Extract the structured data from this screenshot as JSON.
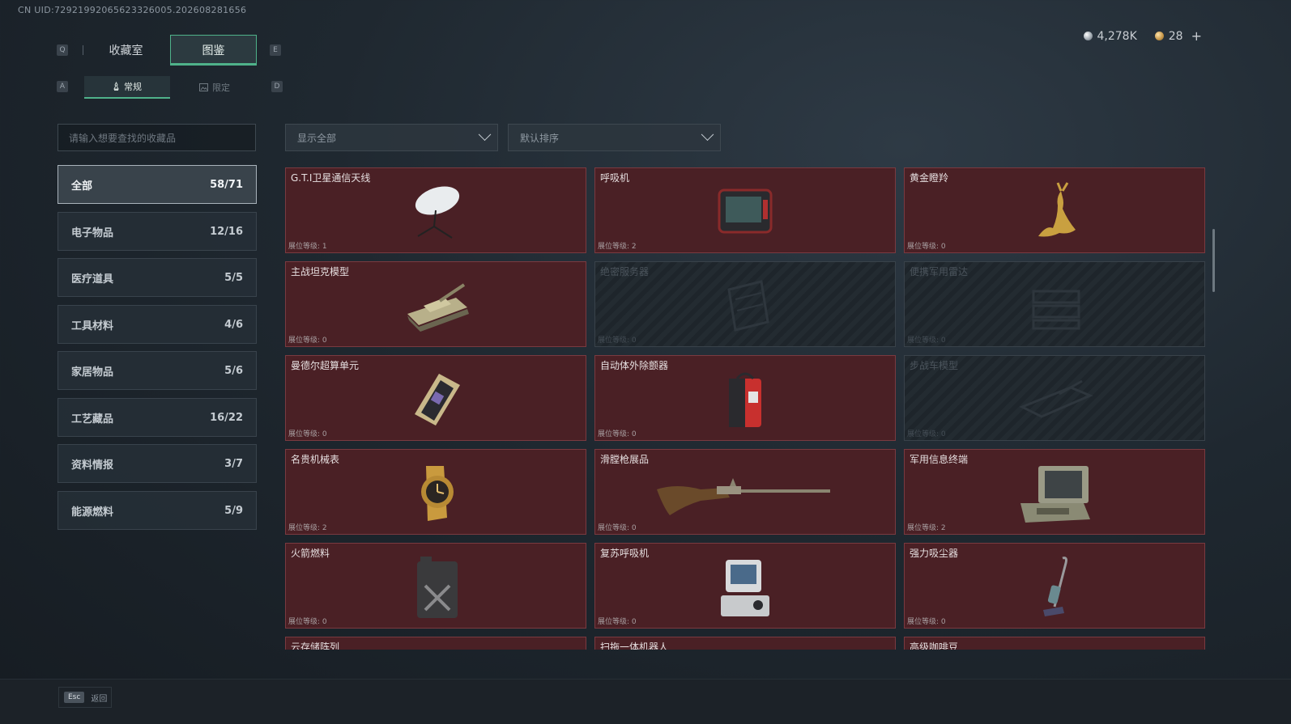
{
  "uid_text": "CN UID:72921992065623326005.202608281656",
  "currency": {
    "silver": "4,278K",
    "gold": "28",
    "add": "+"
  },
  "keys": {
    "prev_tab": "Q",
    "next_tab": "E",
    "prev_sub": "A",
    "next_sub": "D"
  },
  "tabs": [
    {
      "label": "收藏室"
    },
    {
      "label": "图鉴",
      "active": true
    }
  ],
  "subtabs": [
    {
      "label": "常规",
      "active": true
    },
    {
      "label": "限定"
    }
  ],
  "search": {
    "placeholder": "请输入想要查找的收藏品"
  },
  "filters": {
    "show": "显示全部",
    "sort": "默认排序"
  },
  "categories": [
    {
      "label": "全部",
      "count": "58/71",
      "active": true
    },
    {
      "label": "电子物品",
      "count": "12/16"
    },
    {
      "label": "医疗道具",
      "count": "5/5"
    },
    {
      "label": "工具材料",
      "count": "4/6"
    },
    {
      "label": "家居物品",
      "count": "5/6"
    },
    {
      "label": "工艺藏品",
      "count": "16/22"
    },
    {
      "label": "资料情报",
      "count": "3/7"
    },
    {
      "label": "能源燃料",
      "count": "5/9"
    }
  ],
  "items": [
    {
      "name": "G.T.I卫星通信天线",
      "level": "展位等级: 1",
      "icon": "satellite-dish-icon",
      "locked": false
    },
    {
      "name": "呼吸机",
      "level": "展位等级: 2",
      "icon": "ventilator-icon",
      "locked": false
    },
    {
      "name": "黄金瞪羚",
      "level": "展位等级: 0",
      "icon": "golden-gazelle-icon",
      "locked": false
    },
    {
      "name": "主战坦克模型",
      "level": "展位等级: 0",
      "icon": "tank-model-icon",
      "locked": false
    },
    {
      "name": "绝密服务器",
      "level": "展位等级: 0",
      "icon": "server-icon",
      "locked": true
    },
    {
      "name": "便携军用雷达",
      "level": "展位等级: 0",
      "icon": "radar-icon",
      "locked": true
    },
    {
      "name": "曼德尔超算单元",
      "level": "展位等级: 0",
      "icon": "supercomputer-unit-icon",
      "locked": false
    },
    {
      "name": "自动体外除颤器",
      "level": "展位等级: 0",
      "icon": "defibrillator-icon",
      "locked": false
    },
    {
      "name": "步战车模型",
      "level": "展位等级: 0",
      "icon": "ifv-model-icon",
      "locked": true
    },
    {
      "name": "名贵机械表",
      "level": "展位等级: 2",
      "icon": "watch-icon",
      "locked": false
    },
    {
      "name": "滑膛枪展品",
      "level": "展位等级: 0",
      "icon": "musket-icon",
      "locked": false
    },
    {
      "name": "军用信息终端",
      "level": "展位等级: 2",
      "icon": "military-terminal-icon",
      "locked": false
    },
    {
      "name": "火箭燃料",
      "level": "展位等级: 0",
      "icon": "fuel-can-icon",
      "locked": false
    },
    {
      "name": "复苏呼吸机",
      "level": "展位等级: 0",
      "icon": "resuscitator-icon",
      "locked": false
    },
    {
      "name": "强力吸尘器",
      "level": "展位等级: 0",
      "icon": "vacuum-cleaner-icon",
      "locked": false
    },
    {
      "name": "云存储阵列",
      "level": "",
      "icon": "",
      "locked": false
    },
    {
      "name": "扫拖一体机器人",
      "level": "",
      "icon": "",
      "locked": false
    },
    {
      "name": "高级咖啡豆",
      "level": "",
      "icon": "",
      "locked": false
    }
  ],
  "footer": {
    "esc_key": "Esc",
    "back": "返回"
  }
}
